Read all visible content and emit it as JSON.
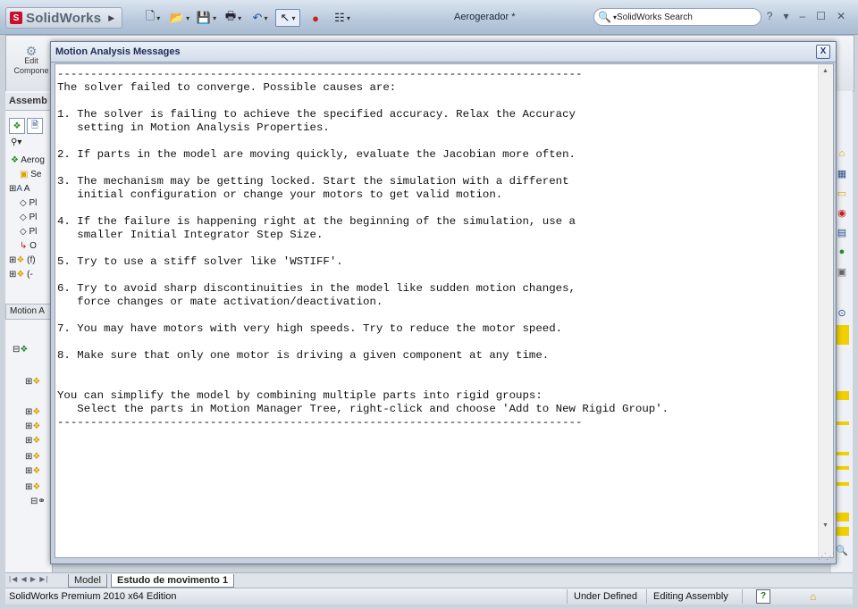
{
  "app": {
    "logo_text": "SolidWorks",
    "document_title": "Aerogerador *",
    "search_placeholder": "SolidWorks Search",
    "help_symbol": "?"
  },
  "left_panel": {
    "edit_component_label": "Edit Compone",
    "assembly_tab": "Assemb",
    "motion_tab": "Motion A",
    "tree_root": "Aerog",
    "tree_items": [
      "Se",
      "A",
      "Pl",
      "Pl",
      "Pl",
      "O",
      "(f)",
      "(-"
    ]
  },
  "dialog": {
    "title": "Motion Analysis Messages",
    "close_label": "X",
    "lines": [
      "-------------------------------------------------------------------------------",
      "The solver failed to converge. Possible causes are:",
      "",
      "1. The solver is failing to achieve the specified accuracy. Relax the Accuracy",
      "   setting in Motion Analysis Properties.",
      "",
      "2. If parts in the model are moving quickly, evaluate the Jacobian more often.",
      "",
      "3. The mechanism may be getting locked. Start the simulation with a different",
      "   initial configuration or change your motors to get valid motion.",
      "",
      "4. If the failure is happening right at the beginning of the simulation, use a",
      "   smaller Initial Integrator Step Size.",
      "",
      "5. Try to use a stiff solver like 'WSTIFF'.",
      "",
      "6. Try to avoid sharp discontinuities in the model like sudden motion changes,",
      "   force changes or mate activation/deactivation.",
      "",
      "7. You may have motors with very high speeds. Try to reduce the motor speed.",
      "",
      "8. Make sure that only one motor is driving a given component at any time.",
      "",
      "",
      "You can simplify the model by combining multiple parts into rigid groups:",
      "   Select the parts in Motion Manager Tree, right-click and choose 'Add to New Rigid Group'.",
      "-------------------------------------------------------------------------------"
    ]
  },
  "bottom_tabs": {
    "model": "Model",
    "study": "Estudo de movimento 1"
  },
  "status": {
    "edition": "SolidWorks Premium 2010 x64 Edition",
    "definition": "Under Defined",
    "mode": "Editing Assembly",
    "help_symbol": "?"
  }
}
